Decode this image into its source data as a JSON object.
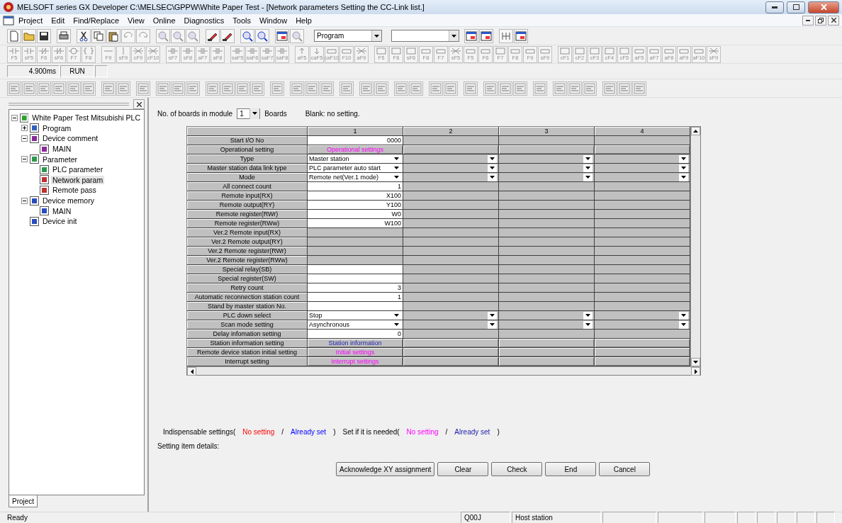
{
  "window": {
    "title": "MELSOFT series GX Developer C:\\MELSEC\\GPPW\\White Paper Test - [Network parameters  Setting the CC-Link list.]"
  },
  "menu": [
    "Project",
    "Edit",
    "Find/Replace",
    "View",
    "Online",
    "Diagnostics",
    "Tools",
    "Window",
    "Help"
  ],
  "toolbar": {
    "program_select": {
      "value": "Program"
    }
  },
  "ladder_keys": [
    {
      "label": "F5",
      "kind": "contact"
    },
    {
      "label": "sF5",
      "kind": "contact"
    },
    {
      "label": "F6",
      "kind": "contact_nc"
    },
    {
      "label": "sF6",
      "kind": "contact_nc"
    },
    {
      "label": "F7",
      "kind": "coil"
    },
    {
      "label": "F8",
      "kind": "instruction"
    },
    {
      "label": "F9",
      "kind": "hline"
    },
    {
      "label": "sF9",
      "kind": "vline"
    },
    {
      "label": "cF9",
      "kind": "cross"
    },
    {
      "label": "cF10",
      "kind": "cross"
    },
    {
      "label": "sF7",
      "kind": "pulse"
    },
    {
      "label": "sF8",
      "kind": "pulse"
    },
    {
      "label": "aF7",
      "kind": "pulse"
    },
    {
      "label": "aF8",
      "kind": "pulse"
    },
    {
      "label": "saF5",
      "kind": "pulse"
    },
    {
      "label": "saF6",
      "kind": "pulse"
    },
    {
      "label": "saF7",
      "kind": "pulse"
    },
    {
      "label": "saF8",
      "kind": "pulse"
    },
    {
      "label": "aF5",
      "kind": "arrow_up"
    },
    {
      "label": "caF5",
      "kind": "arrow_down"
    },
    {
      "label": "caF10",
      "kind": "line"
    },
    {
      "label": "F10",
      "kind": "line"
    },
    {
      "label": "aF9",
      "kind": "cross"
    },
    {
      "label": "F5",
      "kind": "box"
    },
    {
      "label": "F6",
      "kind": "box"
    },
    {
      "label": "sF6",
      "kind": "box"
    },
    {
      "label": "F8",
      "kind": "line"
    },
    {
      "label": "F7",
      "kind": "line"
    },
    {
      "label": "sF5",
      "kind": "cross"
    },
    {
      "label": "F5",
      "kind": "line"
    },
    {
      "label": "F6",
      "kind": "line"
    },
    {
      "label": "F7",
      "kind": "box"
    },
    {
      "label": "F8",
      "kind": "line"
    },
    {
      "label": "F9",
      "kind": "line"
    },
    {
      "label": "sF9",
      "kind": "line"
    },
    {
      "label": "cF1",
      "kind": "box"
    },
    {
      "label": "cF2",
      "kind": "box"
    },
    {
      "label": "cF3",
      "kind": "box"
    },
    {
      "label": "cF4",
      "kind": "box"
    },
    {
      "label": "cF5",
      "kind": "box"
    },
    {
      "label": "aF5",
      "kind": "line"
    },
    {
      "label": "aF7",
      "kind": "line"
    },
    {
      "label": "aF8",
      "kind": "line"
    },
    {
      "label": "aF9",
      "kind": "line"
    },
    {
      "label": "aF10",
      "kind": "line"
    },
    {
      "label": "sF9",
      "kind": "cross"
    }
  ],
  "scan_status": {
    "scan_time": "4.900ms",
    "mode": "RUN"
  },
  "tree": [
    {
      "label": "White Paper Test Mitsubishi PLC",
      "expanded": true,
      "selected": false,
      "children": [
        {
          "label": "Program",
          "expanded": false,
          "selected": false
        },
        {
          "label": "Device comment",
          "expanded": true,
          "selected": false,
          "children": [
            {
              "label": "MAIN",
              "selected": false
            }
          ]
        },
        {
          "label": "Parameter",
          "expanded": true,
          "selected": false,
          "children": [
            {
              "label": "PLC parameter",
              "selected": false
            },
            {
              "label": "Network param",
              "selected": true
            },
            {
              "label": "Remote pass",
              "selected": false
            }
          ]
        },
        {
          "label": "Device memory",
          "expanded": true,
          "selected": false,
          "children": [
            {
              "label": "MAIN",
              "selected": false
            }
          ]
        },
        {
          "label": "Device init",
          "selected": false
        }
      ]
    }
  ],
  "sidebar_tabs": [
    {
      "label": "Project",
      "selected": true
    }
  ],
  "boards": {
    "label": "No. of boards in module",
    "value": "1",
    "unit": "Boards",
    "note": "Blank: no setting."
  },
  "table": {
    "columns": [
      "1",
      "2",
      "3",
      "4"
    ],
    "rows": [
      {
        "label": "Start I/O No",
        "kind": "input",
        "value": "0000"
      },
      {
        "label": "Operational setting",
        "kind": "button",
        "value": "Operational settings",
        "required": false,
        "set": false
      },
      {
        "label": "Type",
        "kind": "select",
        "value": "Master station"
      },
      {
        "label": "Master station data link type",
        "kind": "select",
        "value": "PLC parameter auto start"
      },
      {
        "label": "Mode",
        "kind": "select",
        "value": "Remote net(Ver.1 mode)"
      },
      {
        "label": "All connect count",
        "kind": "input",
        "value": "1"
      },
      {
        "label": "Remote input(RX)",
        "kind": "input",
        "value": "X100"
      },
      {
        "label": "Remote output(RY)",
        "kind": "input",
        "value": "Y100"
      },
      {
        "label": "Remote register(RWr)",
        "kind": "input",
        "value": "W0"
      },
      {
        "label": "Remote register(RWw)",
        "kind": "input",
        "value": "W100"
      },
      {
        "label": "Ver.2 Remote input(RX)",
        "kind": "disabled"
      },
      {
        "label": "Ver.2 Remote output(RY)",
        "kind": "disabled"
      },
      {
        "label": "Ver.2 Remote register(RWr)",
        "kind": "disabled"
      },
      {
        "label": "Ver.2 Remote register(RWw)",
        "kind": "disabled"
      },
      {
        "label": "Special relay(SB)",
        "kind": "input"
      },
      {
        "label": "Special register(SW)",
        "kind": "input"
      },
      {
        "label": "Retry count",
        "kind": "input",
        "value": "3"
      },
      {
        "label": "Automatic reconnection station count",
        "kind": "input",
        "value": "1"
      },
      {
        "label": "Stand by master station No.",
        "kind": "input"
      },
      {
        "label": "PLC down select",
        "kind": "select",
        "value": "Stop"
      },
      {
        "label": "Scan mode setting",
        "kind": "select",
        "value": "Asynchronous"
      },
      {
        "label": "Delay infomation setting",
        "kind": "input",
        "value": "0"
      },
      {
        "label": "Station information setting",
        "kind": "button",
        "value": "Station information",
        "required": false,
        "set": true
      },
      {
        "label": "Remote device station initial setting",
        "kind": "button",
        "value": "Initial settings",
        "required": false,
        "set": false
      },
      {
        "label": "Interrupt setting",
        "kind": "button",
        "value": "Interrupt settings",
        "required": false,
        "set": false
      }
    ]
  },
  "legend": [
    {
      "text": "Indispensable settings("
    },
    {
      "text": "No setting",
      "required": true,
      "set": false
    },
    {
      "text": "/"
    },
    {
      "text": "Already set",
      "required": true,
      "set": true
    },
    {
      "text": ")"
    },
    {
      "text": "Set if it is needed("
    },
    {
      "text": "No setting",
      "required": false,
      "set": false
    },
    {
      "text": "/"
    },
    {
      "text": "Already set",
      "required": false,
      "set": true
    },
    {
      "text": ")"
    }
  ],
  "details_label": "Setting item details:",
  "buttons": [
    "Acknowledge XY assignment",
    "Clear",
    "Check",
    "End",
    "Cancel"
  ],
  "status_bar": {
    "message": "Ready",
    "cpu": "Q00J",
    "station": "Host station"
  }
}
